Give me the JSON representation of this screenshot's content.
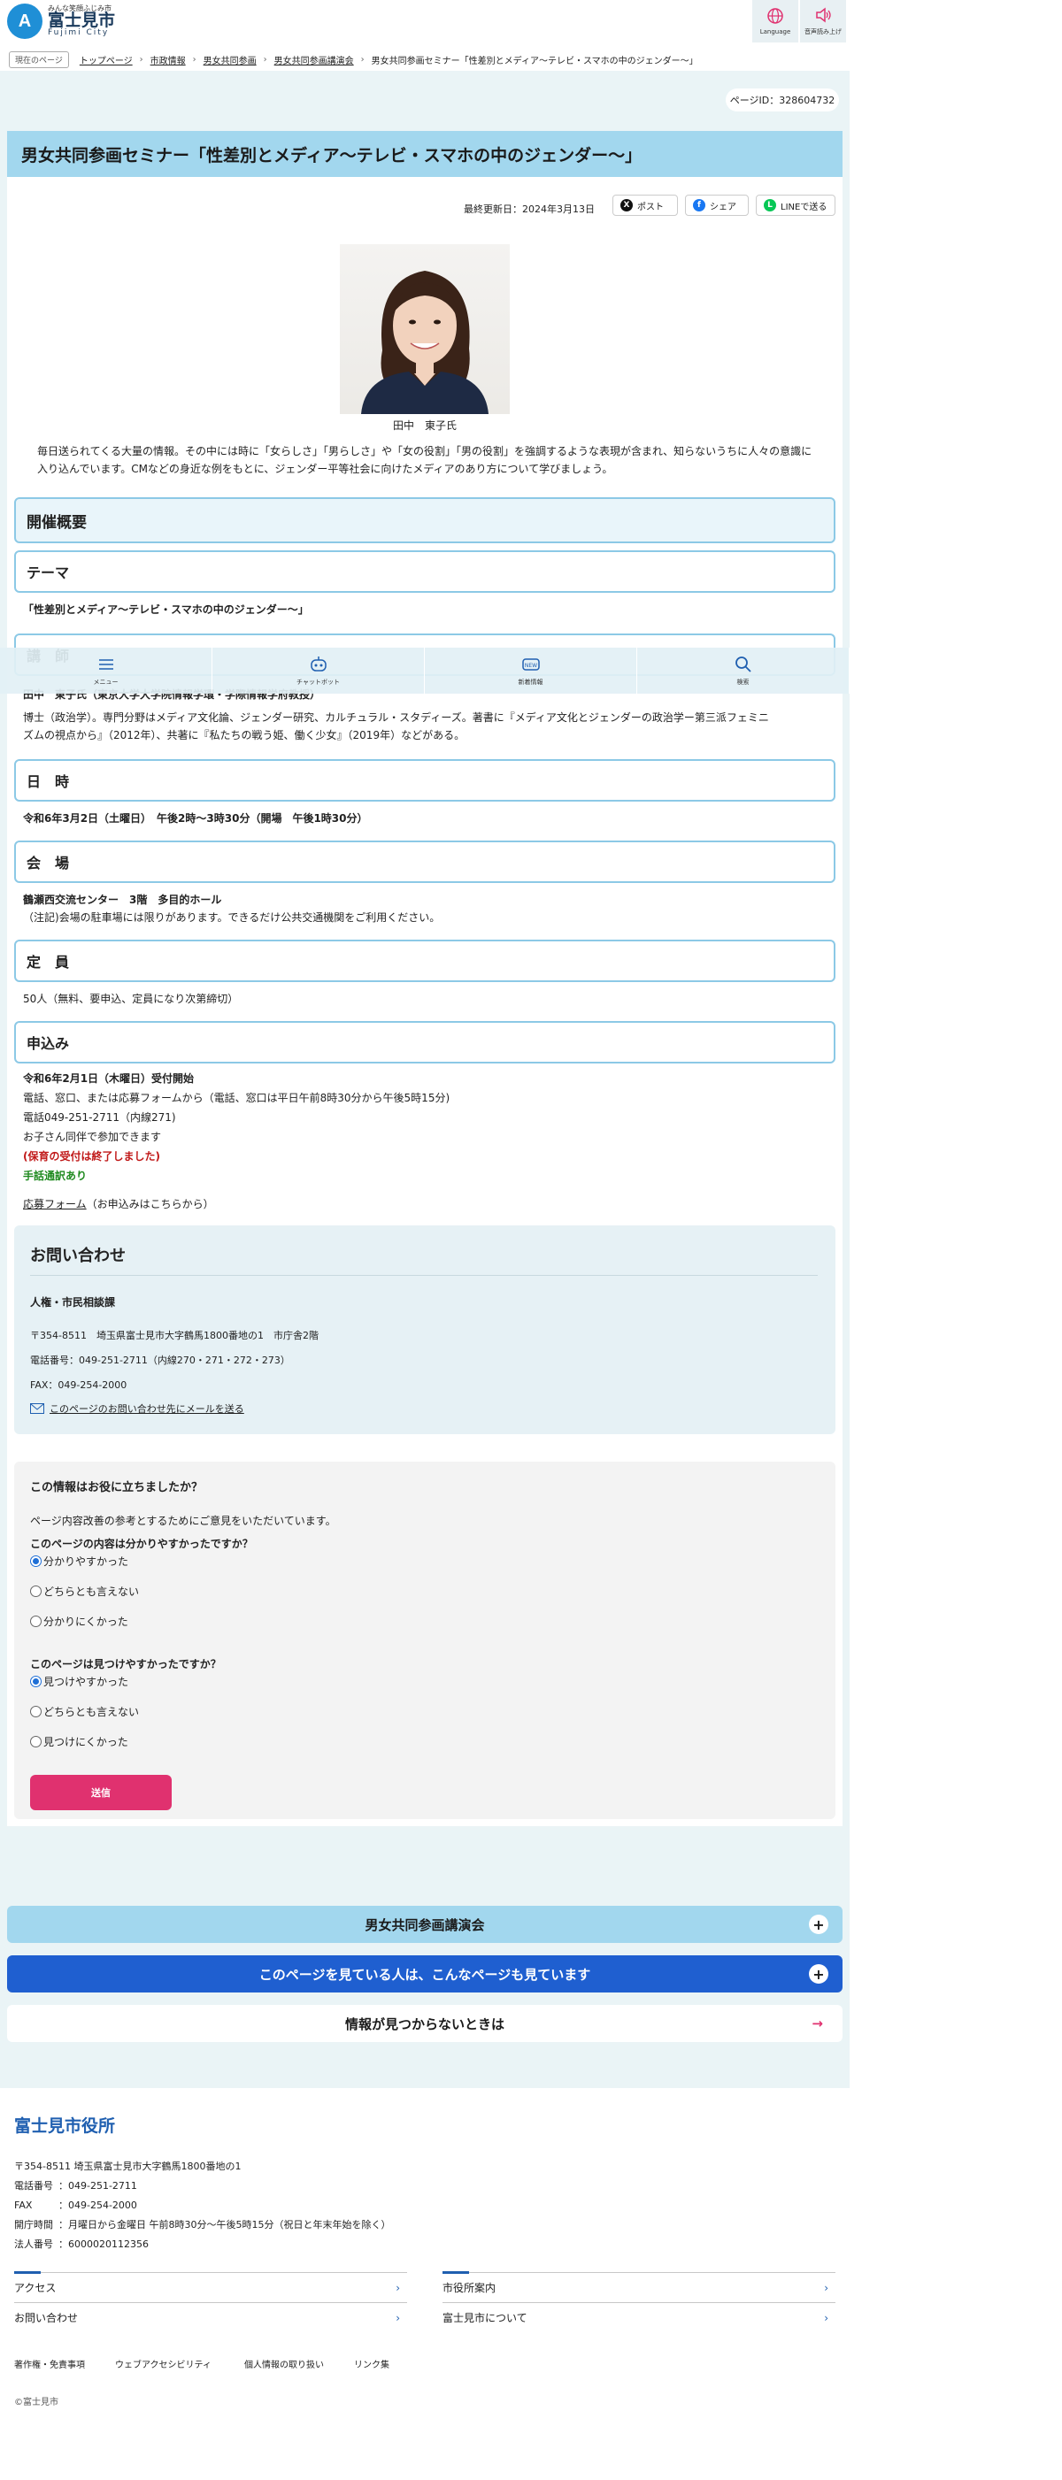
{
  "header": {
    "logo_small": "みんな笑顔ふじみ市",
    "logo_name": "富士見市",
    "logo_en": "Fujimi City",
    "language_label": "Language",
    "speech_label": "音声読み上げ"
  },
  "breadcrumb": {
    "current_label": "現在のページ",
    "items": [
      "トップページ",
      "市政情報",
      "男女共同参画",
      "男女共同参画講演会"
    ],
    "current": "男女共同参画セミナー「性差別とメディア〜テレビ・スマホの中のジェンダー〜」"
  },
  "page_id": "ページID：328604732",
  "title": "男女共同参画セミナー「性差別とメディア〜テレビ・スマホの中のジェンダー〜」",
  "updated": "最終更新日：2024年3月13日",
  "share": {
    "post": "ポスト",
    "share": "シェア",
    "line": "LINEで送る"
  },
  "photo_caption": "田中　東子氏",
  "intro": "毎日送られてくる大量の情報。その中には時に「女らしさ」「男らしさ」や「女の役割」「男の役割」を強調するような表現が含まれ、知らないうちに人々の意識に入り込んでいます。CMなどの身近な例をもとに、ジェンダー平等社会に向けたメディアのあり方について学びましょう。",
  "sections": {
    "overview": "開催概要",
    "theme_h": "テーマ",
    "theme": "「性差別とメディア〜テレビ・スマホの中のジェンダー〜」",
    "lecturer_h": "講　師",
    "lecturer_name": "田中　東子氏（東京大学大学院情報学環・学際情報学府教授）",
    "lecturer_bio_1": "博士（政治学）。専門分野はメディア文化論、ジェンダー研究、カルチュラル・スタディーズ。著書に『メディア文化とジェンダーの政治学ー第三派フェミニ",
    "lecturer_bio_2": "ズムの視点から』（2012年）、共著に『私たちの戦う姫、働く少女』（2019年）などがある。",
    "date_h": "日　時",
    "date": "令和6年3月2日（土曜日）　午後2時〜3時30分（開場　午後1時30分）",
    "venue_h": "会　場",
    "venue": "鶴瀬西交流センター　3階　多目的ホール",
    "venue_note": "（注記)会場の駐車場には限りがあります。できるだけ公共交通機関をご利用ください。",
    "capacity_h": "定　員",
    "capacity": "50人（無料、要申込、定員になり次第締切）",
    "apply_h": "申込み",
    "apply_start": "令和6年2月1日（木曜日）受付開始",
    "apply_method": "電話、窓口、または応募フォームから（電話、窓口は平日午前8時30分から午後5時15分)",
    "apply_phone": "電話049-251-2711（内線271)",
    "apply_children": "お子さん同伴で参加できます",
    "apply_childcare": "(保育の受付は終了しました)",
    "apply_sign": "手話通訳あり",
    "form_link": "応募フォーム",
    "form_note": "（お申込みはこちらから）"
  },
  "floatnav": [
    "メニュー",
    "チャットボット",
    "新着情報",
    "検索"
  ],
  "contact": {
    "title": "お問い合わせ",
    "dept": "人権・市民相談課",
    "address": "〒354-8511　埼玉県富士見市大字鶴馬1800番地の1　市庁舎2階",
    "phone": "電話番号：049-251-2711（内線270・271・272・273）",
    "fax": "FAX：049-254-2000",
    "mail_link": "このページのお問い合わせ先にメールを送る"
  },
  "survey": {
    "title": "この情報はお役に立ちましたか？",
    "lead": "ページ内容改善の参考とするためにご意見をいただいています。",
    "q1": "このページの内容は分かりやすかったですか？",
    "q1_options": [
      "分かりやすかった",
      "どちらとも言えない",
      "分かりにくかった"
    ],
    "q2": "このページは見つけやすかったですか？",
    "q2_options": [
      "見つけやすかった",
      "どちらとも言えない",
      "見つけにくかった"
    ],
    "submit": "送信"
  },
  "accordions": {
    "related": "男女共同参画講演会",
    "popular": "このページを見ている人は、こんなページも見ています",
    "notfound": "情報が見つからないときは"
  },
  "footer": {
    "title": "富士見市役所",
    "address": "〒354-8511 埼玉県富士見市大字鶴馬1800番地の1",
    "phone_label": "電話番号",
    "phone": "：049-251-2711",
    "fax_label": "FAX",
    "fax": "：049-254-2000",
    "hours_label": "開庁時間",
    "hours": "：月曜日から金曜日 午前8時30分〜午後5時15分（祝日と年末年始を除く）",
    "corp_label": "法人番号",
    "corp": "：6000020112356",
    "links": [
      "アクセス",
      "市役所案内",
      "お問い合わせ",
      "富士見市について"
    ],
    "bottom_links": [
      "著作権・免責事項",
      "ウェブアクセシビリティ",
      "個人情報の取り扱い",
      "リンク集"
    ],
    "copyright": "©富士見市"
  },
  "colors": {
    "title_bar": "#a2d7ee",
    "accent_blue": "#1f5fb0",
    "submit": "#e0316f",
    "popular_bar": "#1f5fd0"
  }
}
